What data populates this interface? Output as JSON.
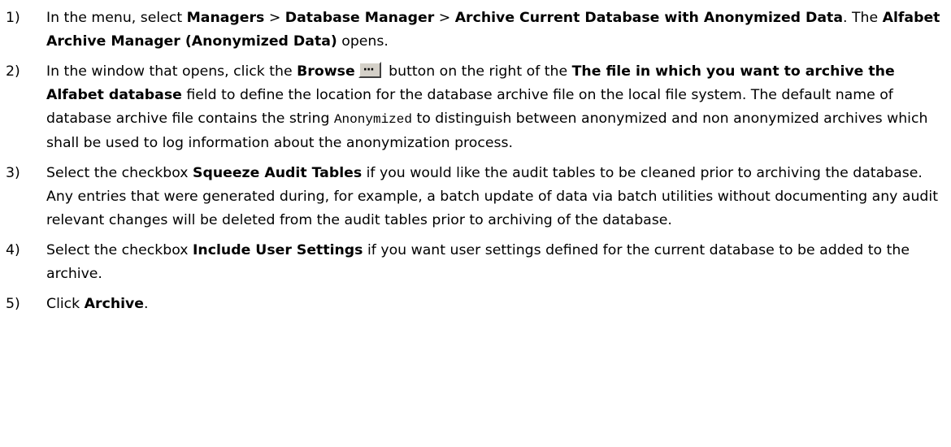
{
  "steps": [
    {
      "num": "1)",
      "p1": "In the menu, select ",
      "b1": "Managers",
      "p2": " > ",
      "b2": "Database Manager",
      "p3": " > ",
      "b3": "Archive Current Database with Anonymized Data",
      "p4": ". The ",
      "b4": "Alfabet Archive Manager (Anonymized Data)",
      "p5": " opens."
    },
    {
      "num": "2)",
      "p1": "In the window that opens, click the ",
      "b1": "Browse",
      "icon": "browse-button-icon",
      "p2": " button on the right of the ",
      "b2": "The file in which you want to archive the Alfabet database",
      "p3": " field to define the location for the database archive file on the local file system. The default name of database archive file contains the string ",
      "code": "Anonymized",
      "p4": " to distinguish between anonymized and non anonymized archives which shall be used to log information about the anonymization process."
    },
    {
      "num": "3)",
      "p1": "Select the checkbox ",
      "b1": "Squeeze Audit Tables",
      "p2": " if you would like the audit tables to be cleaned prior to archiving the database. Any entries that were generated during, for example, a batch update of data via batch utilities without documenting any audit relevant changes will be deleted from the audit tables prior to archiving of the database."
    },
    {
      "num": "4)",
      "p1": "Select the checkbox ",
      "b1": "Include User Settings",
      "p2": " if you want user settings defined for the current database to be added to the archive."
    },
    {
      "num": "5)",
      "p1": "Click ",
      "b1": "Archive",
      "p2": "."
    }
  ]
}
